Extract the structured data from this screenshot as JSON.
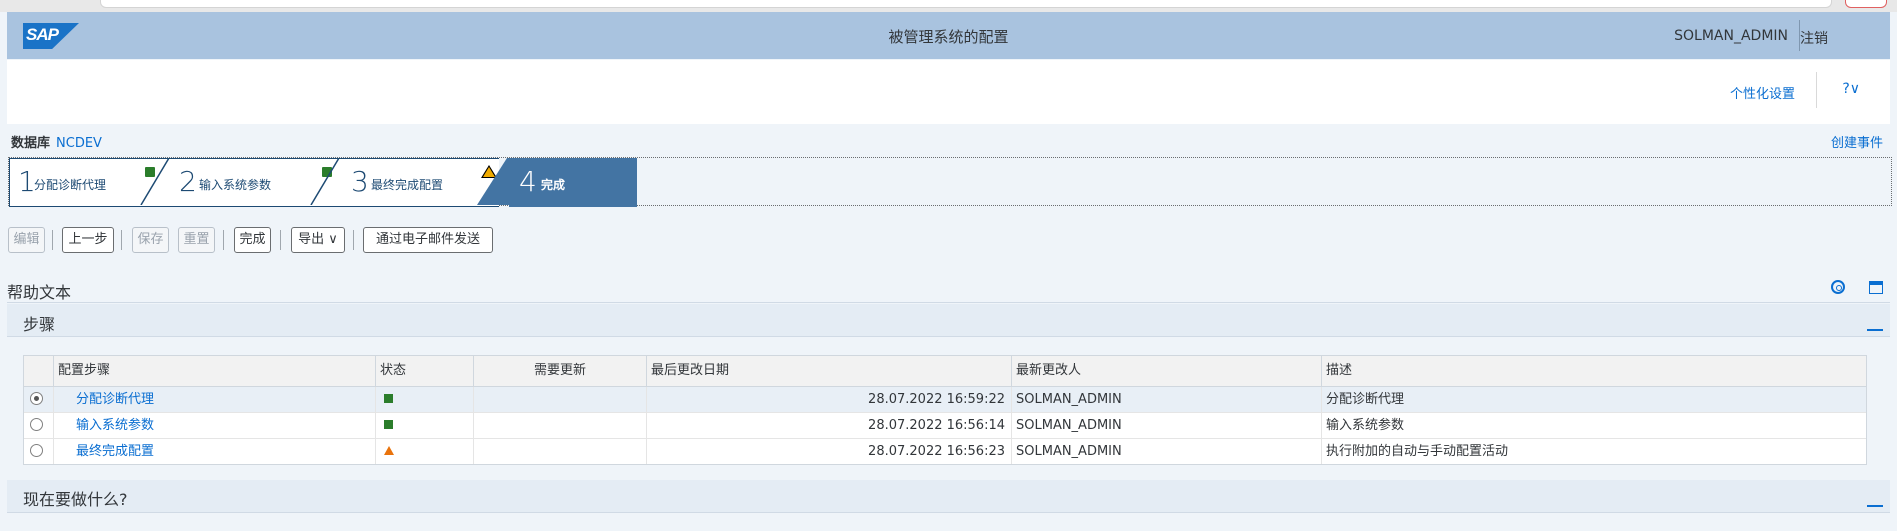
{
  "shell": {
    "logo_text": "SAP",
    "title": "被管理系统的配置",
    "user": "SOLMAN_ADMIN",
    "logoff": "注销"
  },
  "toolbar": {
    "personalize": "个性化设置",
    "help": "?∨"
  },
  "context": {
    "db_label": "数据库",
    "db_value": "NCDEV",
    "create_event": "创建事件"
  },
  "roadmap": [
    {
      "number": "1",
      "label": "分配诊断代理",
      "status": "green"
    },
    {
      "number": "2",
      "label": "输入系统参数",
      "status": "green"
    },
    {
      "number": "3",
      "label": "最终完成配置",
      "status": "warning"
    },
    {
      "number": "4",
      "label": "完成",
      "status": "active"
    }
  ],
  "buttons": {
    "edit": "编辑",
    "prev": "上一步",
    "save": "保存",
    "reset": "重置",
    "finish": "完成",
    "export": "导出 ∨",
    "send_email": "通过电子邮件发送"
  },
  "sections": {
    "help_text": "帮助文本",
    "steps": "步骤",
    "what_next": "现在要做什么?"
  },
  "table": {
    "columns": [
      "配置步骤",
      "状态",
      "需要更新",
      "最后更改日期",
      "最新更改人",
      "描述"
    ],
    "rows": [
      {
        "step": "分配诊断代理",
        "status": "green",
        "needs_update": "",
        "date": "28.07.2022 16:59:22",
        "user": "SOLMAN_ADMIN",
        "desc": "分配诊断代理",
        "selected": true
      },
      {
        "step": "输入系统参数",
        "status": "green",
        "needs_update": "",
        "date": "28.07.2022 16:56:14",
        "user": "SOLMAN_ADMIN",
        "desc": "输入系统参数",
        "selected": false
      },
      {
        "step": "最终完成配置",
        "status": "warning",
        "needs_update": "",
        "date": "28.07.2022 16:56:23",
        "user": "SOLMAN_ADMIN",
        "desc": "执行附加的自动与手动配置活动",
        "selected": false
      }
    ]
  },
  "colors": {
    "shell_bg": "#a9c3df",
    "accent": "#0a6ed1",
    "active_step": "#4374a3",
    "status_green": "#2b7d2b",
    "status_warning": "#e9730c"
  }
}
